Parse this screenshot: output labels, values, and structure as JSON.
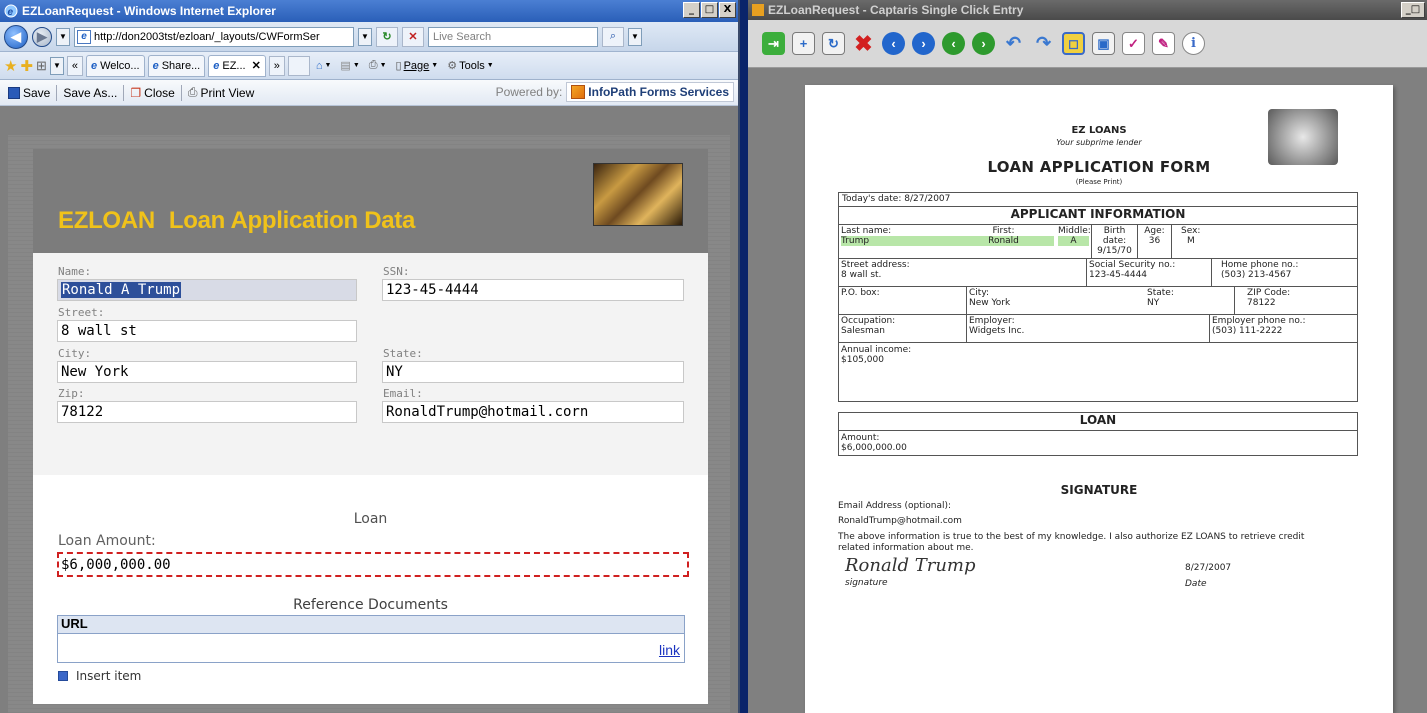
{
  "left": {
    "title": "EZLoanRequest - Windows Internet Explorer",
    "win_btns": [
      "_",
      "□",
      "X"
    ],
    "address": "http://don2003tst/ezloan/_layouts/CWFormSer",
    "search_placeholder": "Live Search",
    "tabs": [
      "Welco...",
      "Share...",
      "EZ..."
    ],
    "tab_more": "»",
    "tab_prev": "«",
    "commands": {
      "page": "Page",
      "tools": "Tools"
    },
    "infobar": {
      "save": "Save",
      "save_as": "Save As...",
      "close": "Close",
      "print_view": "Print View",
      "powered_by": "Powered by:",
      "infopath": "InfoPath Forms Services"
    },
    "form": {
      "title_a": "EZLOAN",
      "title_b": "Loan Application Data",
      "labels": {
        "name": "Name:",
        "ssn": "SSN:",
        "street": "Street:",
        "city": "City:",
        "state": "State:",
        "zip": "Zip:",
        "email": "Email:"
      },
      "values": {
        "name": "Ronald A Trump",
        "ssn": "123-45-4444",
        "street": "8 wall st",
        "city": "New York",
        "state": "NY",
        "zip": "78122",
        "email": "RonaldTrump@hotmail.corn"
      },
      "loan_section": "Loan",
      "loan_amount_label": "Loan Amount:",
      "loan_amount": "$6,000,000.00",
      "ref_section": "Reference Documents",
      "ref_col": "URL",
      "ref_link": "link",
      "insert_item": "Insert item"
    }
  },
  "right": {
    "title": "EZLoanRequest - Captaris Single Click Entry",
    "win_btn": "_□",
    "paper": {
      "brand": "EZ LOANS",
      "tagline": "Your subprime lender",
      "form_title": "LOAN APPLICATION FORM",
      "note": "(Please Print)",
      "today": "Today's date:  8/27/2007",
      "applicant_head": "APPLICANT INFORMATION",
      "last_name_l": "Last name:",
      "last_name": "Trump",
      "first_l": "First:",
      "first": "Ronald",
      "middle_l": "Middle:",
      "middle": "A",
      "birth_l": "Birth date:",
      "birth": "9/15/70",
      "age_l": "Age:",
      "age": "36",
      "sex_l": "Sex:",
      "sex": "M",
      "street_l": "Street address:",
      "street": "8 wall st.",
      "ssn_l": "Social Security no.:",
      "ssn": "123-45-4444",
      "home_l": "Home phone no.:",
      "home": "(503) 213-4567",
      "pobox_l": "P.O. box:",
      "city_l": "City:",
      "city": "New York",
      "state_l": "State:",
      "state": "NY",
      "zip_l": "ZIP Code:",
      "zip": "78122",
      "occ_l": "Occupation:",
      "occ": "Salesman",
      "emp_l": "Employer:",
      "emp": "Widgets Inc.",
      "empph_l": "Employer phone no.:",
      "empph": "(503) 111-2222",
      "income_l": "Annual income:",
      "income": "$105,000",
      "loan_head": "LOAN",
      "amount_l": "Amount:",
      "amount": "$6,000,000.00",
      "sig_head": "SIGNATURE",
      "email_l": "Email Address (optional):",
      "email": "RonaldTrump@hotmail.com",
      "statement": "The above information is true to the best of my knowledge.  I also authorize EZ LOANS to retrieve credit related information about me.",
      "sig_date": "8/27/2007",
      "sig_label": "signature",
      "date_label": "Date"
    }
  }
}
